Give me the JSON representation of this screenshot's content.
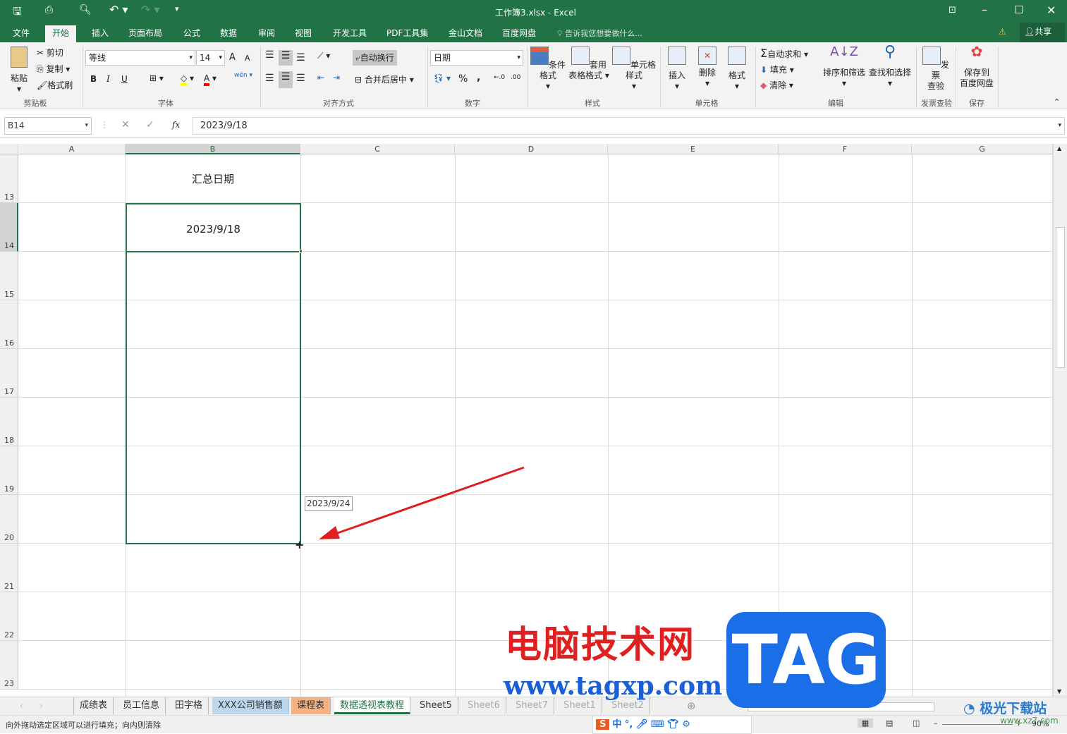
{
  "title": "工作簿3.xlsx - Excel",
  "qat": {
    "save": "save-icon",
    "print_preview": "print-preview-icon",
    "undo": "undo-icon",
    "redo": "redo-icon"
  },
  "ribbon_tabs": [
    "文件",
    "开始",
    "插入",
    "页面布局",
    "公式",
    "数据",
    "审阅",
    "视图",
    "开发工具",
    "PDF工具集",
    "金山文档",
    "百度网盘"
  ],
  "tell_me": "告诉我您想要做什么...",
  "share": "共享",
  "clipboard": {
    "paste": "粘贴",
    "cut": "剪切",
    "copy": "复制",
    "format_painter": "格式刷",
    "group": "剪贴板"
  },
  "font": {
    "name": "等线",
    "size": "14",
    "bold": "B",
    "italic": "I",
    "underline": "U",
    "group": "字体",
    "grow": "A",
    "shrink": "A",
    "phonetic": "wén"
  },
  "alignment": {
    "wrap": "自动换行",
    "merge": "合并后居中",
    "group": "对齐方式"
  },
  "number": {
    "format": "日期",
    "percent": "%",
    "comma": ",",
    "group": "数字"
  },
  "styles": {
    "conditional": "条件格式",
    "table_fmt_1": "套用",
    "table_fmt_2": "表格格式",
    "cell_styles": "单元格样式",
    "group": "样式"
  },
  "cells": {
    "insert": "插入",
    "delete": "删除",
    "format": "格式",
    "group": "单元格"
  },
  "editing": {
    "autosum": "自动求和",
    "fill": "填充",
    "clear": "清除",
    "sort": "排序和筛选",
    "find": "查找和选择",
    "group": "编辑"
  },
  "invoice": {
    "label1": "发票",
    "label2": "查验",
    "group": "发票查验"
  },
  "save_baidu": {
    "label1": "保存到",
    "label2": "百度网盘",
    "group": "保存"
  },
  "formula_bar": {
    "name_box": "B14",
    "fx": "fx",
    "value": "2023/9/18"
  },
  "columns": [
    "A",
    "B",
    "C",
    "D",
    "E",
    "F",
    "G"
  ],
  "rows": [
    "13",
    "14",
    "15",
    "16",
    "17",
    "18",
    "19",
    "20",
    "21",
    "22",
    "23"
  ],
  "cells_data": {
    "B13": "汇总日期",
    "B14": "2023/9/18"
  },
  "fill_tooltip": "2023/9/24",
  "sheet_tabs": [
    {
      "name": "成绩表"
    },
    {
      "name": "员工信息"
    },
    {
      "name": "田字格"
    },
    {
      "name": "XXX公司销售额",
      "color": "#bdd7ee"
    },
    {
      "name": "课程表",
      "color": "#f4b183"
    },
    {
      "name": "数据透视表教程",
      "active": true
    },
    {
      "name": "Sheet5"
    },
    {
      "name": "Sheet6"
    },
    {
      "name": "Sheet7"
    },
    {
      "name": "Sheet1"
    },
    {
      "name": "Sheet2"
    }
  ],
  "status_text": "向外拖动选定区域可以进行填充；向内则清除",
  "zoom": "90%",
  "ime": [
    "中",
    "°,"
  ],
  "watermark": {
    "site": "电脑技术网",
    "url": "www.tagxp.com",
    "tag": "TAG",
    "logo2": "极光下载站",
    "url2": "www.xz7.com"
  },
  "colors": {
    "excel_green": "#217346",
    "selection": "#217346",
    "arrow": "#e02020"
  }
}
